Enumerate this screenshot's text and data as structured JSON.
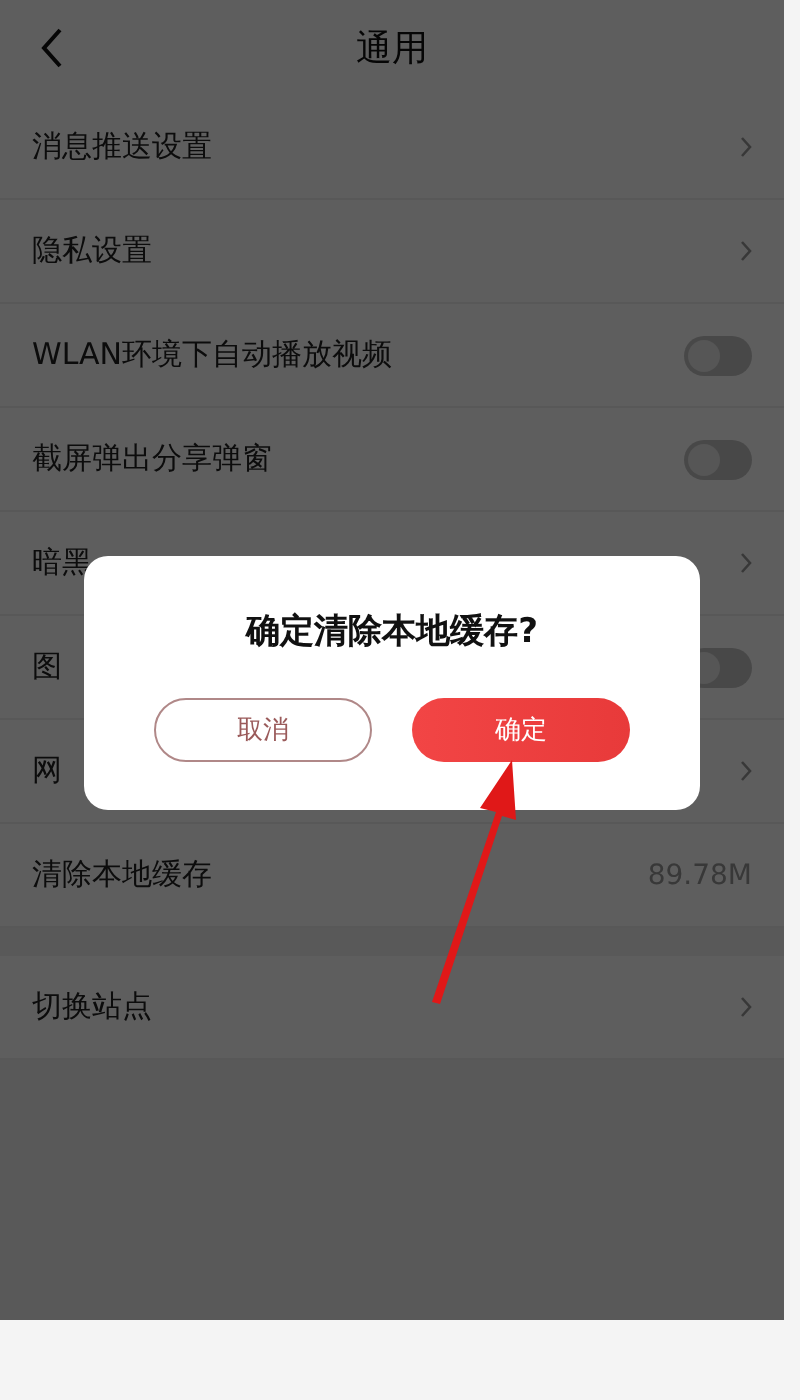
{
  "header": {
    "title": "通用"
  },
  "groups": [
    {
      "rows": [
        {
          "label": "消息推送设置",
          "kind": "link"
        },
        {
          "label": "隐私设置",
          "kind": "link"
        },
        {
          "label": "WLAN环境下自动播放视频",
          "kind": "toggle",
          "on": false
        },
        {
          "label": "截屏弹出分享弹窗",
          "kind": "toggle",
          "on": false
        },
        {
          "label": "暗黑",
          "kind": "link"
        },
        {
          "label": "图",
          "kind": "toggle",
          "on": false
        },
        {
          "label": "网",
          "kind": "link"
        },
        {
          "label": "清除本地缓存",
          "kind": "value",
          "value": "89.78M"
        }
      ]
    },
    {
      "rows": [
        {
          "label": "切换站点",
          "kind": "link"
        }
      ]
    }
  ],
  "dialog": {
    "title": "确定清除本地缓存?",
    "buttons": [
      {
        "label": "取消",
        "kind": "secondary"
      },
      {
        "label": "确定",
        "kind": "primary"
      }
    ]
  }
}
